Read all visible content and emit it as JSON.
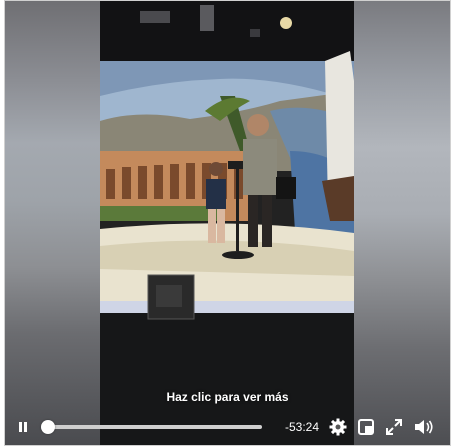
{
  "player": {
    "cta_text": "Haz clic para ver más",
    "time_remaining": "-53:24",
    "progress_fraction": 0.0,
    "icons": {
      "pause": "pause-icon",
      "settings": "gear-icon",
      "pip": "picture-in-picture-icon",
      "fullscreen": "fullscreen-icon",
      "volume": "volume-icon"
    }
  },
  "colors": {
    "control_foreground": "#ffffff",
    "track": "#cfcfcf"
  }
}
